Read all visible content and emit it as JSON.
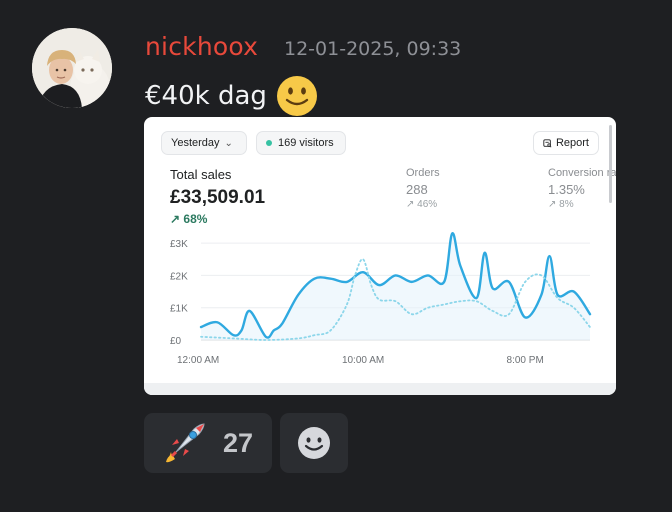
{
  "message": {
    "author": "nickhoox",
    "timestamp": "12-01-2025, 09:33",
    "text": "€40k dag",
    "emoji": "slightly-smiling-face",
    "avatar_icon": "avatar-photo-icon",
    "colors": {
      "author": "#e8493b",
      "background": "#1e1f22"
    }
  },
  "embed": {
    "date_filter": "Yesterday",
    "visitors": "169 visitors",
    "report_label": "Report",
    "total_sales_label": "Total sales",
    "total_sales_value": "£33,509.01",
    "total_sales_change": "68%",
    "orders_label": "Orders",
    "orders_value": "288",
    "orders_change": "46%",
    "conversion_label": "Conversion ra",
    "conversion_value": "1.35%",
    "conversion_change": "8%"
  },
  "reactions": [
    {
      "emoji": "rocket",
      "count": "27"
    },
    {
      "emoji": "add-reaction-smiley"
    }
  ],
  "chart_data": {
    "type": "line",
    "y_tick_labels": [
      "£3K",
      "£2K",
      "£1K",
      "£0"
    ],
    "x_tick_labels": [
      "12:00 AM",
      "10:00 AM",
      "8:00 PM"
    ],
    "ylim": [
      0,
      3500
    ],
    "x_range_hours": [
      0,
      24
    ],
    "series": [
      {
        "style": "solid",
        "color": "#2fa9e0",
        "x": [
          0,
          1,
          2,
          2.5,
          3,
          4,
          4.5,
          5,
          6,
          7,
          8,
          9,
          10,
          11,
          12,
          13,
          14,
          15,
          15.5,
          16,
          17,
          17.5,
          18,
          19,
          20,
          21,
          21.5,
          22,
          23,
          24
        ],
        "y": [
          400,
          550,
          150,
          300,
          900,
          100,
          300,
          500,
          1400,
          1900,
          1900,
          1800,
          2100,
          1700,
          2000,
          1800,
          2000,
          1800,
          3300,
          2300,
          1300,
          2700,
          1600,
          1800,
          700,
          1400,
          2600,
          1400,
          1500,
          800
        ]
      },
      {
        "style": "dotted",
        "color": "#8cd6ea",
        "x": [
          0,
          2,
          4,
          6,
          7,
          8,
          9,
          9.5,
          10,
          10.5,
          11,
          12,
          13,
          14,
          15,
          16,
          17,
          18,
          19,
          20,
          21,
          22,
          23,
          24
        ],
        "y": [
          100,
          50,
          0,
          50,
          150,
          300,
          1100,
          2000,
          2500,
          1700,
          1250,
          1200,
          800,
          1000,
          1100,
          1200,
          1200,
          900,
          800,
          1800,
          2000,
          1300,
          1000,
          400
        ]
      }
    ]
  }
}
